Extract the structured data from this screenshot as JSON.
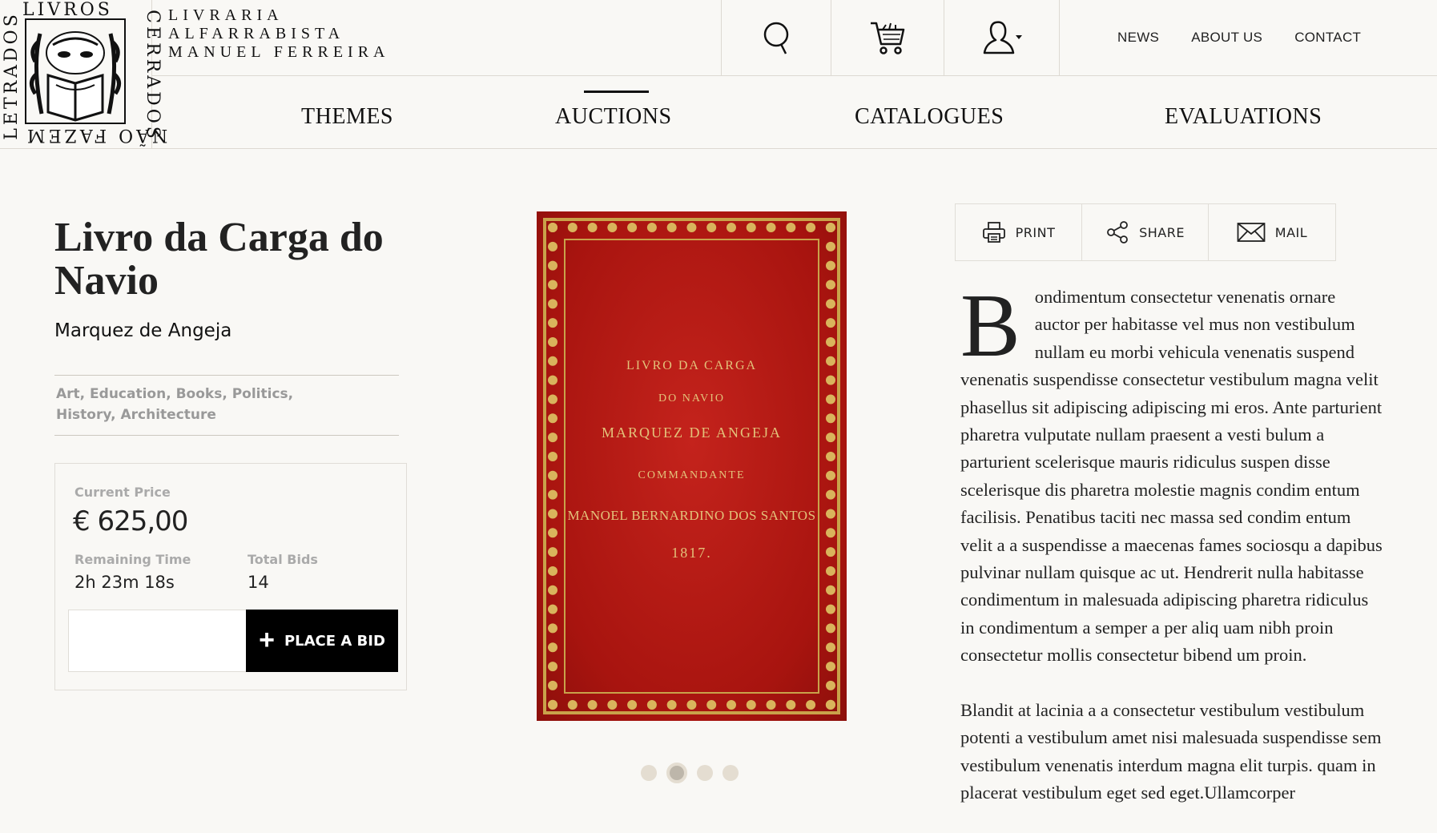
{
  "logo": {
    "top_word": "LIVROS",
    "right_word": "CERRADOS",
    "bottom_word": "NÃO FAZEM",
    "left_word": "LETRADOS"
  },
  "brand": {
    "line1": "LIVRARIA",
    "line2": "ALFARRABISTA",
    "line3": "MANUEL FERREIRA"
  },
  "top_icons": [
    "search-icon",
    "cart-icon",
    "user-icon"
  ],
  "top_nav": {
    "news": "NEWS",
    "about": "ABOUT US",
    "contact": "CONTACT"
  },
  "main_nav": {
    "themes": "THEMES",
    "auctions": "AUCTIONS",
    "catalogues": "CATALOGUES",
    "evaluations": "EVALUATIONS",
    "active": "AUCTIONS"
  },
  "product": {
    "title": "Livro da Carga do Navio",
    "author": "Marquez de Angeja",
    "tags": "Art, Education, Books, Politics, History, Architecture"
  },
  "auction": {
    "price_label": "Current Price",
    "price": "€ 625,00",
    "time_label": "Remaining Time",
    "time": "2h 23m 18s",
    "bids_label": "Total Bids",
    "bids": "14",
    "bid_input_value": "",
    "bid_button": "PLACE A BID"
  },
  "book_cover": {
    "line1": "LIVRO DA CARGA",
    "line2": "DO NAVIO",
    "line3": "MARQUEZ DE ANGEJA",
    "line4": "COMMANDANTE",
    "line5": "MANOEL BERNARDINO DOS SANTOS",
    "line6": "1817."
  },
  "carousel": {
    "count": 4,
    "active_index": 1
  },
  "actions": {
    "print": "PRINT",
    "share": "SHARE",
    "mail": "MAIL"
  },
  "description": {
    "dropcap": "B",
    "para1": "ondimentum consectetur venenatis ornare auctor per habitasse vel mus non vestibulum nullam eu morbi vehicula venenatis suspend venenatis suspendisse consectetur vestibulum magna velit phasellus sit adipiscing adipiscing mi eros. Ante parturient pharetra vulputate nullam praesent a vesti bulum a parturient scelerisque mauris ridiculus suspen disse scelerisque dis pharetra molestie magnis condim entum facilisis. Penatibus taciti nec massa sed condim entum velit a a suspendisse a maecenas fames sociosqu a dapibus pulvinar nullam quisque ac ut. Hendrerit nulla habitasse condimentum in malesuada adipiscing pharetra ridiculus in condimentum a semper a per aliq uam nibh proin consectetur mollis consectetur bibend um proin.",
    "para2": "Blandit at lacinia a a consectetur vestibulum vestibulum potenti a vestibulum amet nisi malesuada suspendisse sem vestibulum venenatis interdum magna elit turpis. quam in placerat vestibulum eget sed eget.Ullamcorper"
  }
}
